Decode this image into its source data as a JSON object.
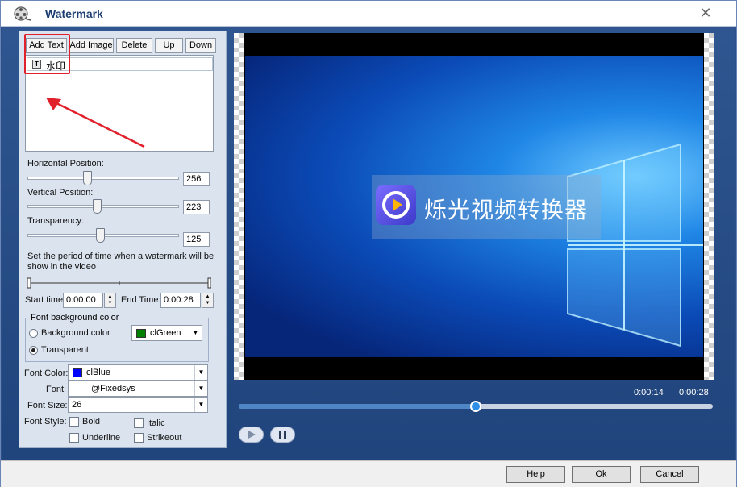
{
  "window": {
    "title": "Watermark"
  },
  "toolbar": {
    "add_text": "Add Text",
    "add_image": "Add Image",
    "delete": "Delete",
    "up": "Up",
    "down": "Down"
  },
  "watermark_list": [
    {
      "type_icon": "T",
      "text": "水印"
    }
  ],
  "positions": {
    "horizontal_label": "Horizontal Position:",
    "horizontal_value": "256",
    "vertical_label": "Vertical Position:",
    "vertical_value": "223",
    "transparency_label": "Transparency:",
    "transparency_value": "125"
  },
  "period": {
    "label": "Set the period of time when a watermark will be show in the video",
    "start_label": "Start time:",
    "start_value": "0:00:00",
    "end_label": "End Time:",
    "end_value": "0:00:28"
  },
  "font_bg": {
    "group_label": "Font background color",
    "bg_color_label": "Background color",
    "transparent_label": "Transparent",
    "bg_color_value": "clGreen",
    "bg_swatch": "#008000",
    "selected": "transparent"
  },
  "font": {
    "color_label": "Font Color:",
    "color_value": "clBlue",
    "color_swatch": "#0000ff",
    "font_label": "Font:",
    "font_value": "@Fixedsys",
    "size_label": "Font Size:",
    "size_value": "26",
    "style_label": "Font Style:",
    "bold": "Bold",
    "italic": "Italic",
    "underline": "Underline",
    "strikeout": "Strikeout"
  },
  "preview": {
    "watermark_text": "烁光视频转换器",
    "current_time": "0:00:14",
    "total_time": "0:00:28",
    "progress": 0.5
  },
  "dialog": {
    "help": "Help",
    "ok": "Ok",
    "cancel": "Cancel"
  }
}
